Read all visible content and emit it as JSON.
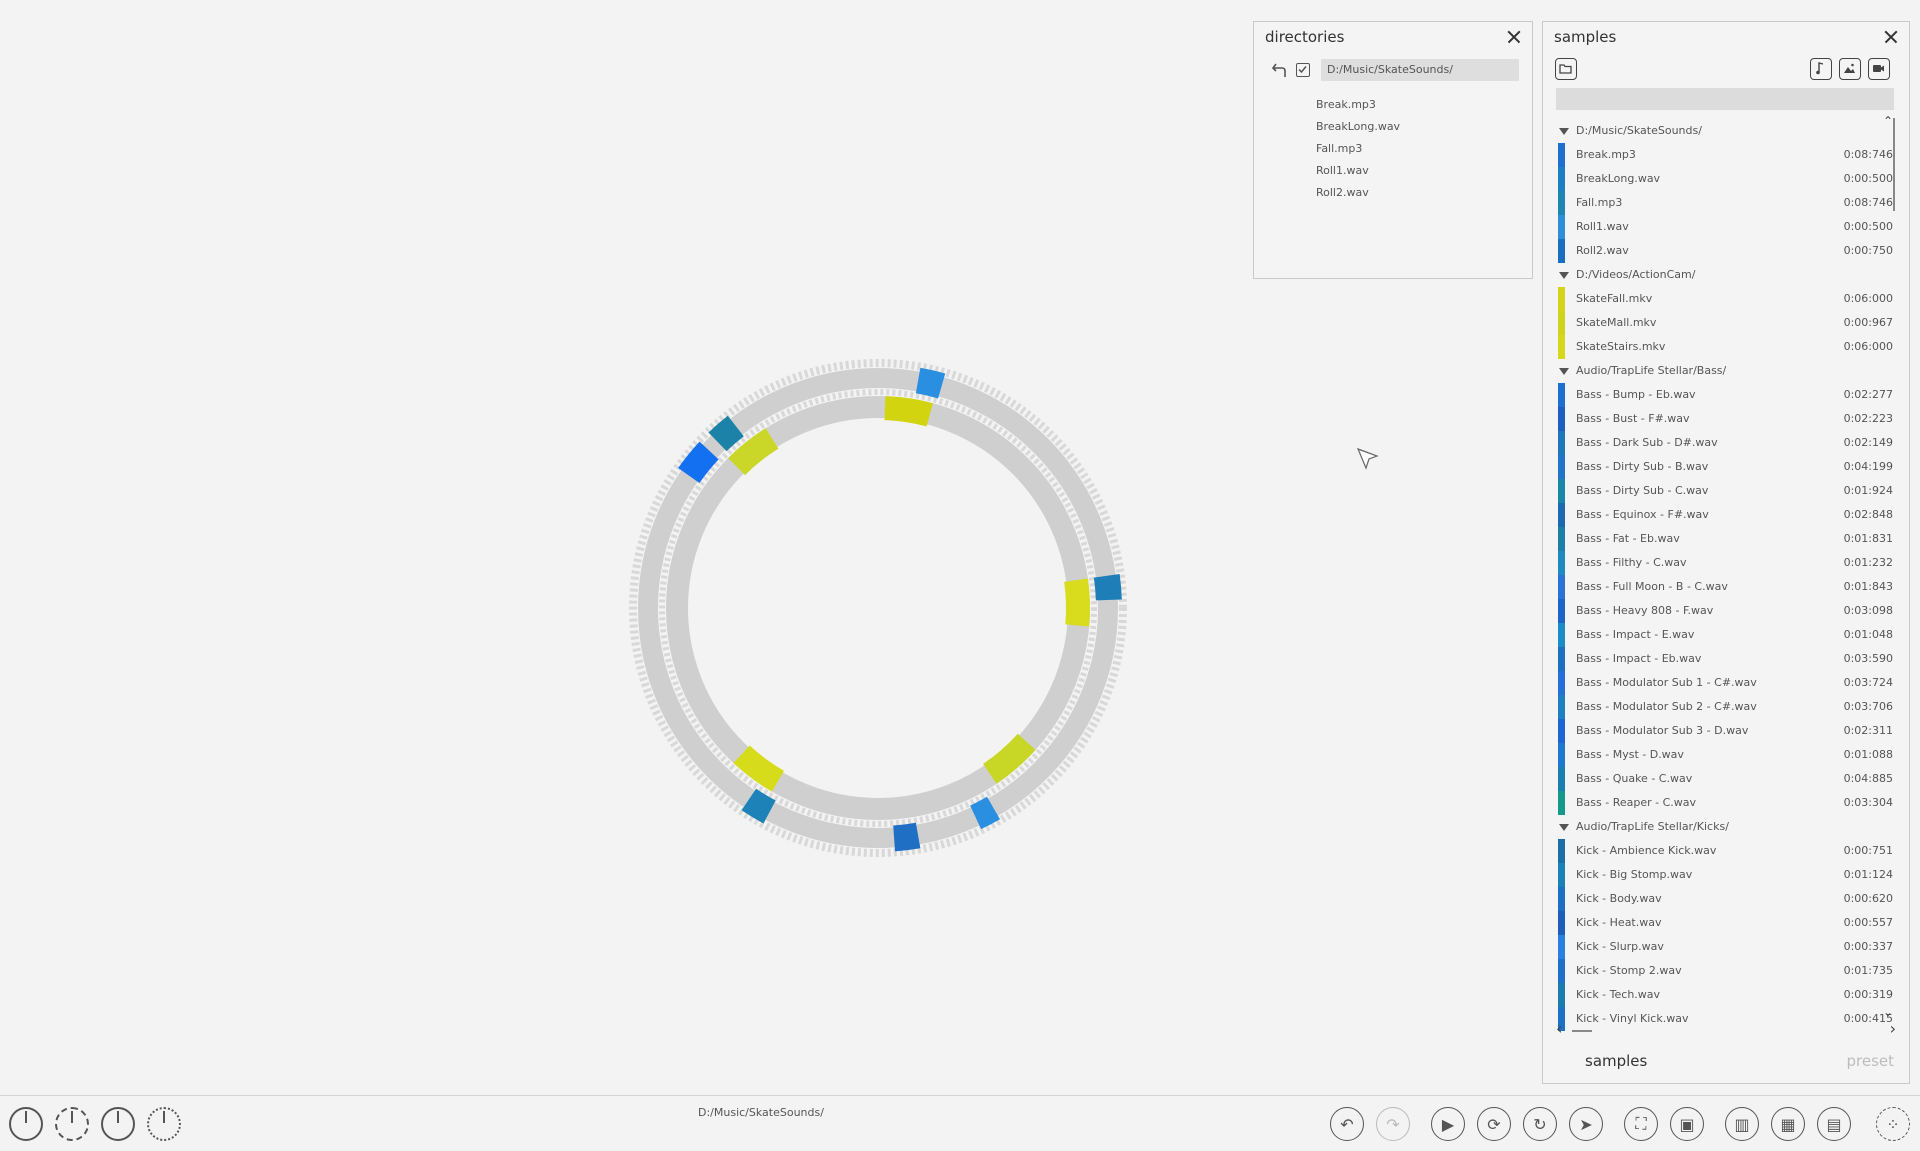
{
  "directories": {
    "title": "directories",
    "path": "D:/Music/SkateSounds/",
    "files": [
      "Break.mp3",
      "BreakLong.wav",
      "Fall.mp3",
      "Roll1.wav",
      "Roll2.wav"
    ]
  },
  "samples": {
    "title": "samples",
    "groups": [
      {
        "path": "D:/Music/SkateSounds/",
        "items": [
          {
            "name": "Break.mp3",
            "dur": "0:08:746",
            "color": "#1f6fcf"
          },
          {
            "name": "BreakLong.wav",
            "dur": "0:00:500",
            "color": "#1c7fc4"
          },
          {
            "name": "Fall.mp3",
            "dur": "0:08:746",
            "color": "#1f86b3"
          },
          {
            "name": "Roll1.wav",
            "dur": "0:00:500",
            "color": "#2e8fd6"
          },
          {
            "name": "Roll2.wav",
            "dur": "0:00:750",
            "color": "#1a6fbf"
          }
        ]
      },
      {
        "path": "D:/Videos/ActionCam/",
        "items": [
          {
            "name": "SkateFall.mkv",
            "dur": "0:06:000",
            "color": "#d4d41a"
          },
          {
            "name": "SkateMall.mkv",
            "dur": "0:00:967",
            "color": "#cfd31c"
          },
          {
            "name": "SkateStairs.mkv",
            "dur": "0:06:000",
            "color": "#d6d81e"
          }
        ]
      },
      {
        "path": "Audio/TrapLife Stellar/Bass/",
        "items": [
          {
            "name": "Bass - Bump - Eb.wav",
            "dur": "0:02:277",
            "color": "#1d6fd0"
          },
          {
            "name": "Bass - Bust - F#.wav",
            "dur": "0:02:223",
            "color": "#1c5fc0"
          },
          {
            "name": "Bass - Dark Sub - D#.wav",
            "dur": "0:02:149",
            "color": "#1e78b8"
          },
          {
            "name": "Bass - Dirty Sub - B.wav",
            "dur": "0:04:199",
            "color": "#2274c8"
          },
          {
            "name": "Bass - Dirty Sub - C.wav",
            "dur": "0:01:924",
            "color": "#1b87a8"
          },
          {
            "name": "Bass - Equinox - F#.wav",
            "dur": "0:02:848",
            "color": "#1d6ab0"
          },
          {
            "name": "Bass - Fat - Eb.wav",
            "dur": "0:01:831",
            "color": "#1b7fa6"
          },
          {
            "name": "Bass - Filthy - C.wav",
            "dur": "0:01:232",
            "color": "#1f8ac0"
          },
          {
            "name": "Bass - Full Moon - B - C.wav",
            "dur": "0:01:843",
            "color": "#2a72d4"
          },
          {
            "name": "Bass - Heavy 808 - F.wav",
            "dur": "0:03:098",
            "color": "#1e64c6"
          },
          {
            "name": "Bass - Impact - E.wav",
            "dur": "0:01:048",
            "color": "#1a8cc6"
          },
          {
            "name": "Bass - Impact - Eb.wav",
            "dur": "0:03:590",
            "color": "#1d6fbf"
          },
          {
            "name": "Bass - Modulator Sub 1 - C#.wav",
            "dur": "0:03:724",
            "color": "#2470d8"
          },
          {
            "name": "Bass - Modulator Sub 2 - C#.wav",
            "dur": "0:03:706",
            "color": "#1e80c0"
          },
          {
            "name": "Bass - Modulator Sub 3 - D.wav",
            "dur": "0:02:311",
            "color": "#1b66d2"
          },
          {
            "name": "Bass - Myst - D.wav",
            "dur": "0:01:088",
            "color": "#1f78d0"
          },
          {
            "name": "Bass - Quake - C.wav",
            "dur": "0:04:885",
            "color": "#1a7fb0"
          },
          {
            "name": "Bass - Reaper - C.wav",
            "dur": "0:03:304",
            "color": "#159a8a"
          }
        ]
      },
      {
        "path": "Audio/TrapLife Stellar/Kicks/",
        "items": [
          {
            "name": "Kick - Ambience Kick.wav",
            "dur": "0:00:751",
            "color": "#1c6ea8"
          },
          {
            "name": "Kick - Big Stomp.wav",
            "dur": "0:01:124",
            "color": "#1b82b8"
          },
          {
            "name": "Kick - Body.wav",
            "dur": "0:00:620",
            "color": "#1e6fc2"
          },
          {
            "name": "Kick - Heat.wav",
            "dur": "0:00:557",
            "color": "#1d5fb8"
          },
          {
            "name": "Kick - Slurp.wav",
            "dur": "0:00:337",
            "color": "#2a80de"
          },
          {
            "name": "Kick - Stomp 2.wav",
            "dur": "0:01:735",
            "color": "#1f70c8"
          },
          {
            "name": "Kick - Tech.wav",
            "dur": "0:00:319",
            "color": "#1b7cb0"
          },
          {
            "name": "Kick - Vinyl Kick.wav",
            "dur": "0:00:415",
            "color": "#1e72c4"
          }
        ]
      }
    ],
    "tab_samples": "samples",
    "tab_preset": "preset"
  },
  "status": {
    "path": "D:/Music/SkateSounds/"
  },
  "colors": {
    "accent_blue": "#1f78d1",
    "accent_yellow": "#d4d41a",
    "ring_gray": "#cfcfcf"
  },
  "ring": {
    "outer_segments": [
      {
        "angle": 10,
        "span": 6,
        "color": "#2a8fe0"
      },
      {
        "angle": 82,
        "span": 6,
        "color": "#1e7fb8"
      },
      {
        "angle": 150,
        "span": 5,
        "color": "#2a8fe0"
      },
      {
        "angle": 170,
        "span": 6,
        "color": "#1f6fc4"
      },
      {
        "angle": 208,
        "span": 6,
        "color": "#1c82b8"
      },
      {
        "angle": 305,
        "span": 8,
        "color": "#1370f0"
      },
      {
        "angle": 316,
        "span": 6,
        "color": "#1c82a8"
      }
    ],
    "inner_segments": [
      {
        "angle": 2,
        "span": 13,
        "color": "#d2d410"
      },
      {
        "angle": 82,
        "span": 13,
        "color": "#d8dc1c"
      },
      {
        "angle": 132,
        "span": 14,
        "color": "#c8d626"
      },
      {
        "angle": 210,
        "span": 13,
        "color": "#d6dc1a"
      },
      {
        "angle": 315,
        "span": 13,
        "color": "#cad628"
      }
    ]
  }
}
